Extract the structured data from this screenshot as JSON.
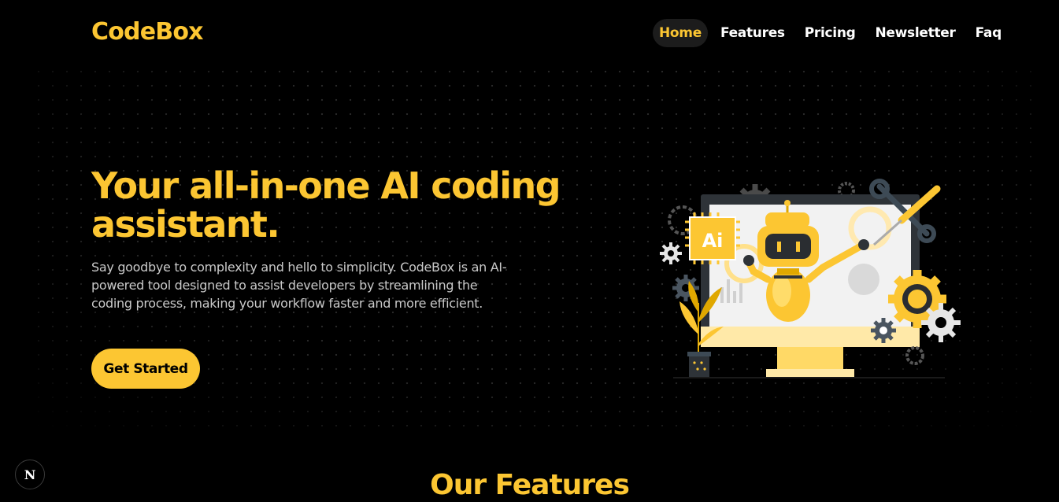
{
  "brand": {
    "logo": "CodeBox",
    "accent_color": "#fcc632",
    "background": "#000000"
  },
  "nav": {
    "items": [
      {
        "label": "Home",
        "active": true
      },
      {
        "label": "Features",
        "active": false
      },
      {
        "label": "Pricing",
        "active": false
      },
      {
        "label": "Newsletter",
        "active": false
      },
      {
        "label": "Faq",
        "active": false
      }
    ]
  },
  "hero": {
    "title": "Your all-in-one AI coding assistant.",
    "description": "Say goodbye to complexity and hello to simplicity. CodeBox is an AI-powered tool designed to assist developers by streamlining the coding process, making your workflow faster and more efficient.",
    "cta_label": "Get Started",
    "illustration": {
      "screen_badge": "Ai",
      "icon": "robot-computer-illustration"
    }
  },
  "features": {
    "title": "Our Features"
  },
  "dev_badge": {
    "label": "N",
    "icon": "nextjs-dev-indicator-icon"
  }
}
